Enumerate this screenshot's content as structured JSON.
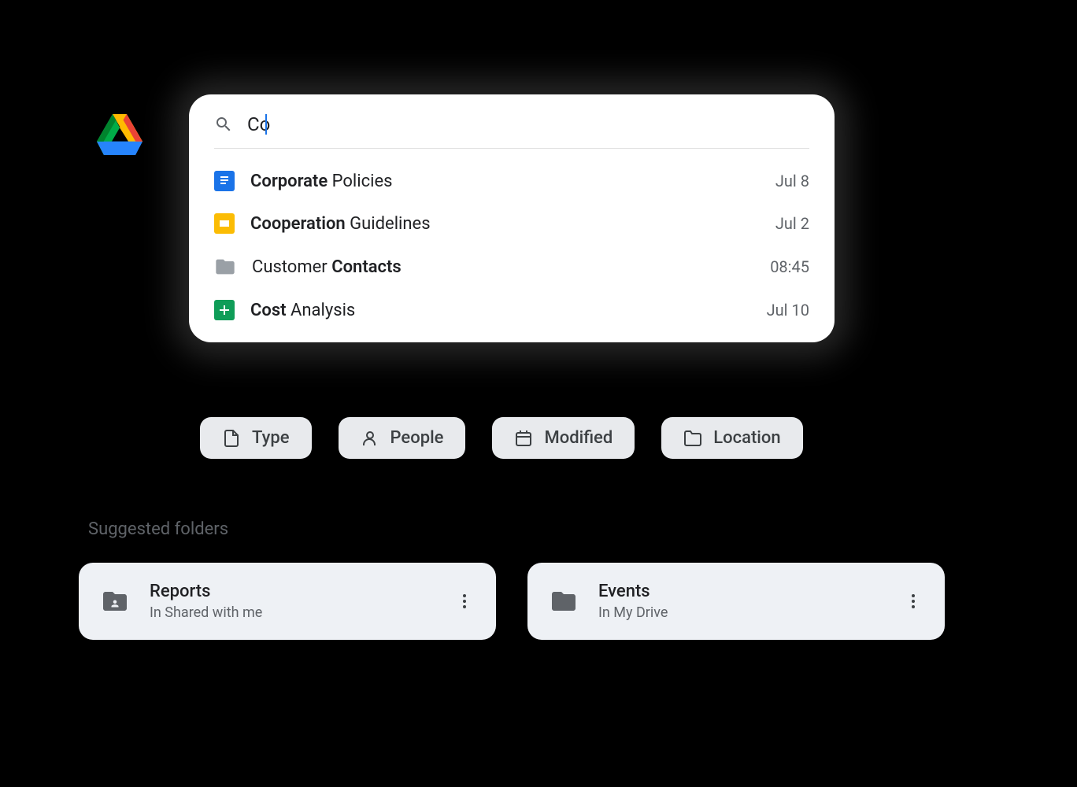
{
  "search": {
    "query": "Co"
  },
  "results": [
    {
      "icon": "docs",
      "nameBold": "Corporate",
      "nameRest": " Policies",
      "date": "Jul 8"
    },
    {
      "icon": "slides",
      "nameBold": "Cooperation",
      "nameRest": " Guidelines",
      "date": "Jul 2"
    },
    {
      "icon": "folder",
      "namePre": "Customer ",
      "nameBold": "Contacts",
      "date": "08:45"
    },
    {
      "icon": "sheets",
      "nameBold": "Cost",
      "nameRest": " Analysis",
      "date": "Jul 10"
    }
  ],
  "filters": [
    {
      "icon": "file",
      "label": "Type"
    },
    {
      "icon": "person",
      "label": "People"
    },
    {
      "icon": "calendar",
      "label": "Modified"
    },
    {
      "icon": "folder-outline",
      "label": "Location"
    }
  ],
  "suggested": {
    "heading": "Suggested folders",
    "folders": [
      {
        "icon": "shared-folder",
        "name": "Reports",
        "location": "In Shared with me"
      },
      {
        "icon": "folder-solid",
        "name": "Events",
        "location": "In My Drive"
      }
    ]
  }
}
